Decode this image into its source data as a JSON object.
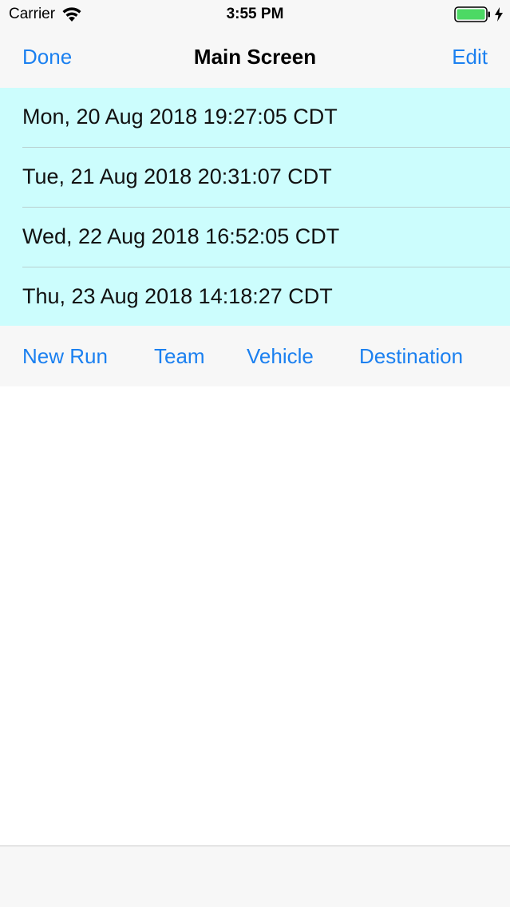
{
  "status_bar": {
    "carrier": "Carrier",
    "time": "3:55 PM",
    "battery_color": "#4cd964"
  },
  "nav": {
    "left_label": "Done",
    "title": "Main Screen",
    "right_label": "Edit"
  },
  "list": {
    "items": [
      {
        "label": "Mon, 20 Aug 2018 19:27:05 CDT"
      },
      {
        "label": "Tue, 21 Aug 2018 20:31:07 CDT"
      },
      {
        "label": "Wed, 22 Aug 2018 16:52:05 CDT"
      },
      {
        "label": "Thu, 23 Aug 2018 14:18:27 CDT"
      }
    ]
  },
  "toolbar": {
    "new_run_label": "New Run",
    "team_label": "Team",
    "vehicle_label": "Vehicle",
    "destination_label": "Destination"
  },
  "colors": {
    "accent": "#1b80f0",
    "list_background": "#ccfdfd",
    "bar_background": "#f7f7f7"
  },
  "icons": {
    "wifi": "wifi-icon",
    "battery": "battery-icon",
    "charging": "charging-bolt-icon"
  }
}
